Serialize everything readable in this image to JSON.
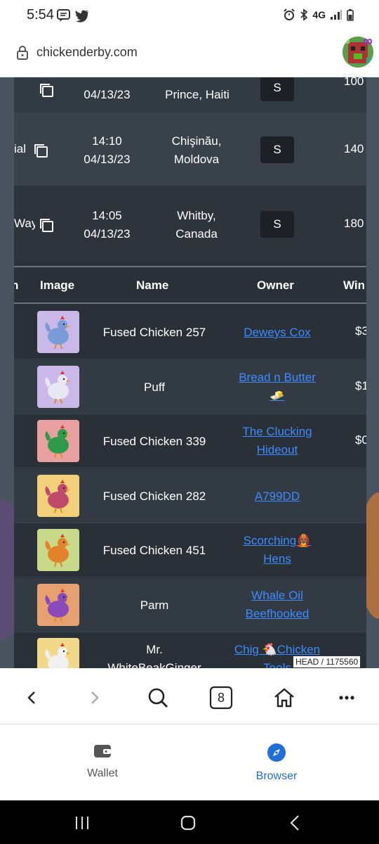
{
  "status_bar": {
    "time": "5:54",
    "network": "4G"
  },
  "browser": {
    "url": "chickenderby.com",
    "tab_count": "8",
    "head_badge": "HEAD / 1175560"
  },
  "races": [
    {
      "name": "",
      "time": "",
      "date": "04/13/23",
      "location_line1": "Prince, Haiti",
      "location_line2": "",
      "distance": "S",
      "fee": "100"
    },
    {
      "name": "ial",
      "time": "14:10",
      "date": "04/13/23",
      "location_line1": "Chişinău,",
      "location_line2": "Moldova",
      "distance": "S",
      "fee": "140"
    },
    {
      "name": "Way",
      "time": "14:05",
      "date": "04/13/23",
      "location_line1": "Whitby,",
      "location_line2": "Canada",
      "distance": "S",
      "fee": "180"
    }
  ],
  "table": {
    "headers": {
      "col0": "n",
      "image": "Image",
      "name": "Name",
      "owner": "Owner",
      "win": "Win"
    },
    "rows": [
      {
        "name_l1": "Fused Chicken 257",
        "name_l2": "",
        "owner_l1": "Deweys Cox",
        "owner_l2": "",
        "win": "$3",
        "bg": "#c9b8e8",
        "body": "#7a9ad8"
      },
      {
        "name_l1": "Puff",
        "name_l2": "",
        "owner_l1": "Bread n Butter",
        "owner_l2": "🧈",
        "win": "$1",
        "bg": "#c9b8e8",
        "body": "#e8e8f4"
      },
      {
        "name_l1": "Fused Chicken 339",
        "name_l2": "",
        "owner_l1": "The Clucking",
        "owner_l2": "Hideout",
        "win": "$0",
        "bg": "#e8a0a0",
        "body": "#2f9a4a"
      },
      {
        "name_l1": "Fused Chicken 282",
        "name_l2": "",
        "owner_l1": "A799DD",
        "owner_l2": "",
        "win": "",
        "bg": "#f2d07a",
        "body": "#c04a6a"
      },
      {
        "name_l1": "Fused Chicken 451",
        "name_l2": "",
        "owner_l1": "Scorching🧑🏾‍🚒",
        "owner_l2": "Hens",
        "win": "",
        "bg": "#c8d98a",
        "body": "#e2822a"
      },
      {
        "name_l1": "Parm",
        "name_l2": "",
        "owner_l1": "Whale Oil",
        "owner_l2": "Beefhooked",
        "win": "",
        "bg": "#e7a070",
        "body": "#8a4ab8"
      },
      {
        "name_l1": "Mr.",
        "name_l2": "WhiteBeakGinger",
        "owner_l1": "Chig 🐔Chicken",
        "owner_l2": "Tools",
        "win": "",
        "bg": "#f2d98a",
        "body": "#f0f0f0"
      }
    ]
  },
  "toolbar": {
    "back_icon": "chevron-left-icon",
    "forward_icon": "chevron-right-icon",
    "search_icon": "search-icon",
    "tabs_icon": "tabs-counter-icon",
    "home_icon": "home-icon",
    "more_icon": "more-dots-icon"
  },
  "app_nav": {
    "wallet_label": "Wallet",
    "browser_label": "Browser",
    "active_color": "#1f6fd6"
  }
}
